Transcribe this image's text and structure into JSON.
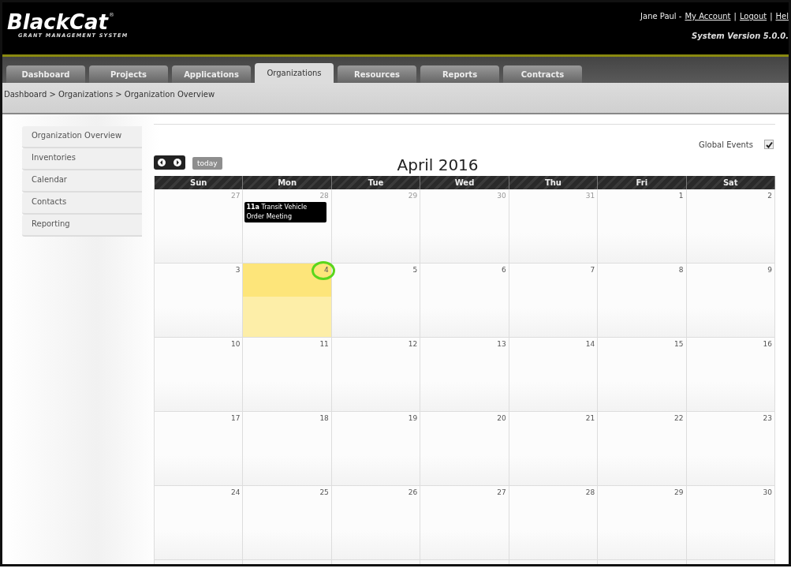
{
  "header": {
    "logo": "BlackCat",
    "logo_mark": "®",
    "tagline": "GRANT MANAGEMENT SYSTEM",
    "user": "Jane Paul -",
    "links": [
      "My Account",
      "Logout",
      "Hel"
    ],
    "separator": "|",
    "version": "System Version 5.0.0."
  },
  "tabs": [
    {
      "label": "Dashboard",
      "selected": false
    },
    {
      "label": "Projects",
      "selected": false
    },
    {
      "label": "Applications",
      "selected": false
    },
    {
      "label": "Organizations",
      "selected": true
    },
    {
      "label": "Resources",
      "selected": false
    },
    {
      "label": "Reports",
      "selected": false
    },
    {
      "label": "Contracts",
      "selected": false
    }
  ],
  "breadcrumb": "Dashboard > Organizations > Organization Overview",
  "sidebar": {
    "items": [
      "Organization Overview",
      "Inventories",
      "Calendar",
      "Contacts",
      "Reporting"
    ]
  },
  "calendar": {
    "title": "April 2016",
    "today_button": "today",
    "global_events": {
      "label": "Global Events",
      "checked": true
    },
    "weekdays": [
      "Sun",
      "Mon",
      "Tue",
      "Wed",
      "Thu",
      "Fri",
      "Sat"
    ],
    "weeks": [
      [
        {
          "day": "27",
          "other_month": true
        },
        {
          "day": "28",
          "other_month": true,
          "events": [
            {
              "time": "11a",
              "title": "Transit Vehicle Order Meeting"
            }
          ]
        },
        {
          "day": "29",
          "other_month": true
        },
        {
          "day": "30",
          "other_month": true
        },
        {
          "day": "31",
          "other_month": true
        },
        {
          "day": "1",
          "other_month": false
        },
        {
          "day": "2",
          "other_month": false
        }
      ],
      [
        {
          "day": "3",
          "other_month": false
        },
        {
          "day": "4",
          "other_month": false,
          "today": true,
          "circled": true
        },
        {
          "day": "5",
          "other_month": false
        },
        {
          "day": "6",
          "other_month": false
        },
        {
          "day": "7",
          "other_month": false
        },
        {
          "day": "8",
          "other_month": false
        },
        {
          "day": "9",
          "other_month": false
        }
      ],
      [
        {
          "day": "10",
          "other_month": false
        },
        {
          "day": "11",
          "other_month": false
        },
        {
          "day": "12",
          "other_month": false
        },
        {
          "day": "13",
          "other_month": false
        },
        {
          "day": "14",
          "other_month": false
        },
        {
          "day": "15",
          "other_month": false
        },
        {
          "day": "16",
          "other_month": false
        }
      ],
      [
        {
          "day": "17",
          "other_month": false
        },
        {
          "day": "18",
          "other_month": false
        },
        {
          "day": "19",
          "other_month": false
        },
        {
          "day": "20",
          "other_month": false
        },
        {
          "day": "21",
          "other_month": false
        },
        {
          "day": "22",
          "other_month": false
        },
        {
          "day": "23",
          "other_month": false
        }
      ],
      [
        {
          "day": "24",
          "other_month": false
        },
        {
          "day": "25",
          "other_month": false
        },
        {
          "day": "26",
          "other_month": false
        },
        {
          "day": "27",
          "other_month": false
        },
        {
          "day": "28",
          "other_month": false
        },
        {
          "day": "29",
          "other_month": false
        },
        {
          "day": "30",
          "other_month": false
        }
      ]
    ]
  }
}
